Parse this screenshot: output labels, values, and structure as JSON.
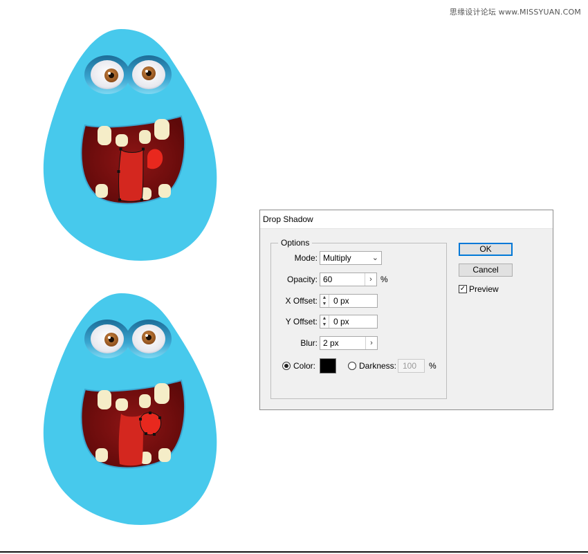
{
  "watermark": "思缘设计论坛 www.MISSYUAN.COM",
  "colors": {
    "monster_body": "#47c9ec",
    "mouth": "#7a1010",
    "tongue": "#e8281e",
    "iris": "#b36b2e",
    "eye_rim": "#2a86b0",
    "anchor_point": "#111111"
  },
  "dialog": {
    "title": "Drop Shadow",
    "options_legend": "Options",
    "mode": {
      "label": "Mode:",
      "value": "Multiply"
    },
    "opacity": {
      "label": "Opacity:",
      "value": "60",
      "unit": "%"
    },
    "x_offset": {
      "label": "X Offset:",
      "value": "0 px"
    },
    "y_offset": {
      "label": "Y Offset:",
      "value": "0 px"
    },
    "blur": {
      "label": "Blur:",
      "value": "2 px"
    },
    "color": {
      "label": "Color:",
      "selected": true,
      "swatch": "#000000"
    },
    "darkness": {
      "label": "Darkness:",
      "value": "100",
      "unit": "%"
    },
    "ok_label": "OK",
    "cancel_label": "Cancel",
    "preview": {
      "label": "Preview",
      "checked": true
    }
  }
}
